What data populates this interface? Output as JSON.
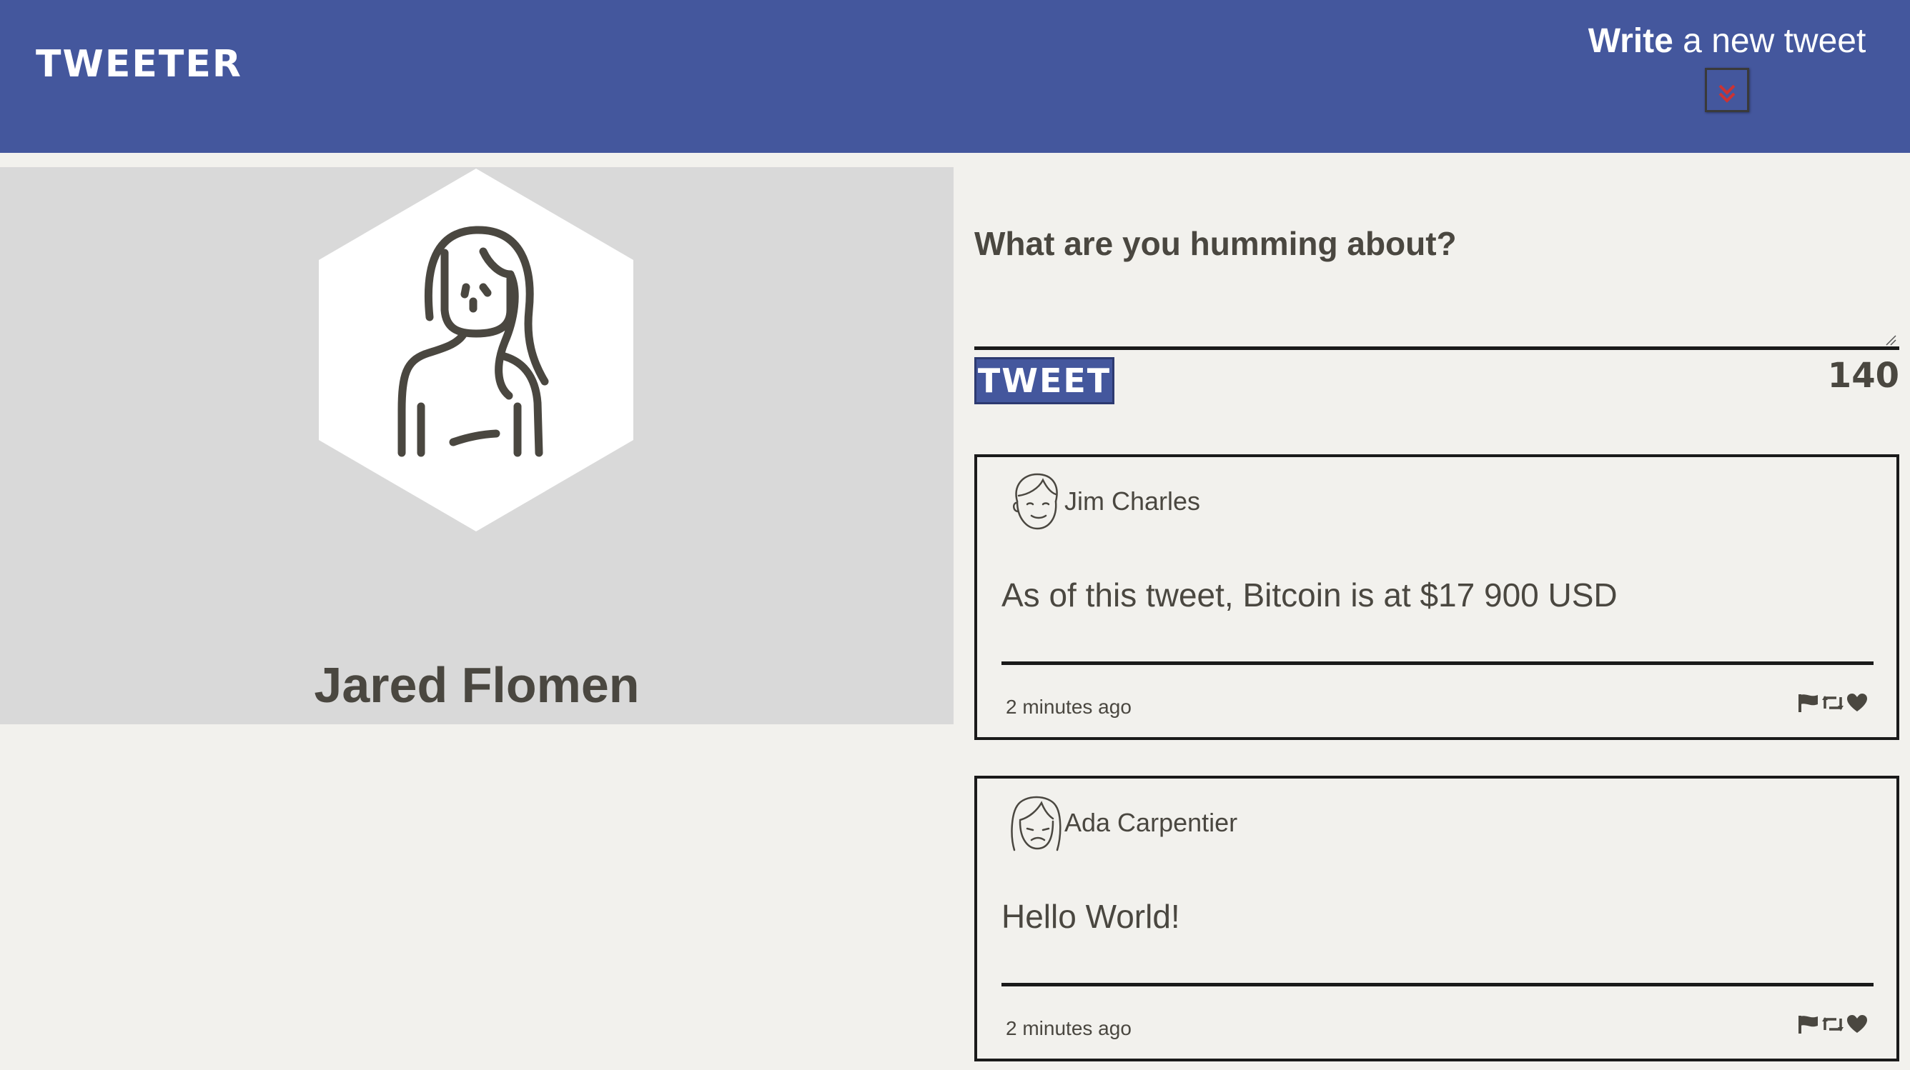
{
  "nav": {
    "brand": "TWEETER",
    "compose_label_bold": "Write",
    "compose_label_rest": " a new tweet",
    "compose_button_icon": "double-chevron-down-icon",
    "compose_button_icon_color": "#cc3333"
  },
  "profile": {
    "name": "Jared Flomen",
    "avatar_icon": "female-user-icon"
  },
  "compose": {
    "title": "What are you humming about?",
    "textarea_value": "",
    "button_label": "TWEET",
    "counter": "140"
  },
  "tweets": [
    {
      "handle": "Jim Charles",
      "avatar_icon": "male-face-icon",
      "content": "As of this tweet, Bitcoin is at $17 900 USD",
      "time": "2 minutes ago",
      "actions": [
        "flag-icon",
        "retweet-icon",
        "heart-icon"
      ]
    },
    {
      "handle": "Ada Carpentier",
      "avatar_icon": "female-face-icon",
      "content": "Hello World!",
      "time": "2 minutes ago",
      "actions": [
        "flag-icon",
        "retweet-icon",
        "heart-icon"
      ]
    }
  ],
  "colors": {
    "nav_background": "#44579d",
    "page_background": "#f2f1ed",
    "profile_background": "#d9d9d9",
    "text": "#4a4740",
    "accent_red": "#cc3333"
  }
}
